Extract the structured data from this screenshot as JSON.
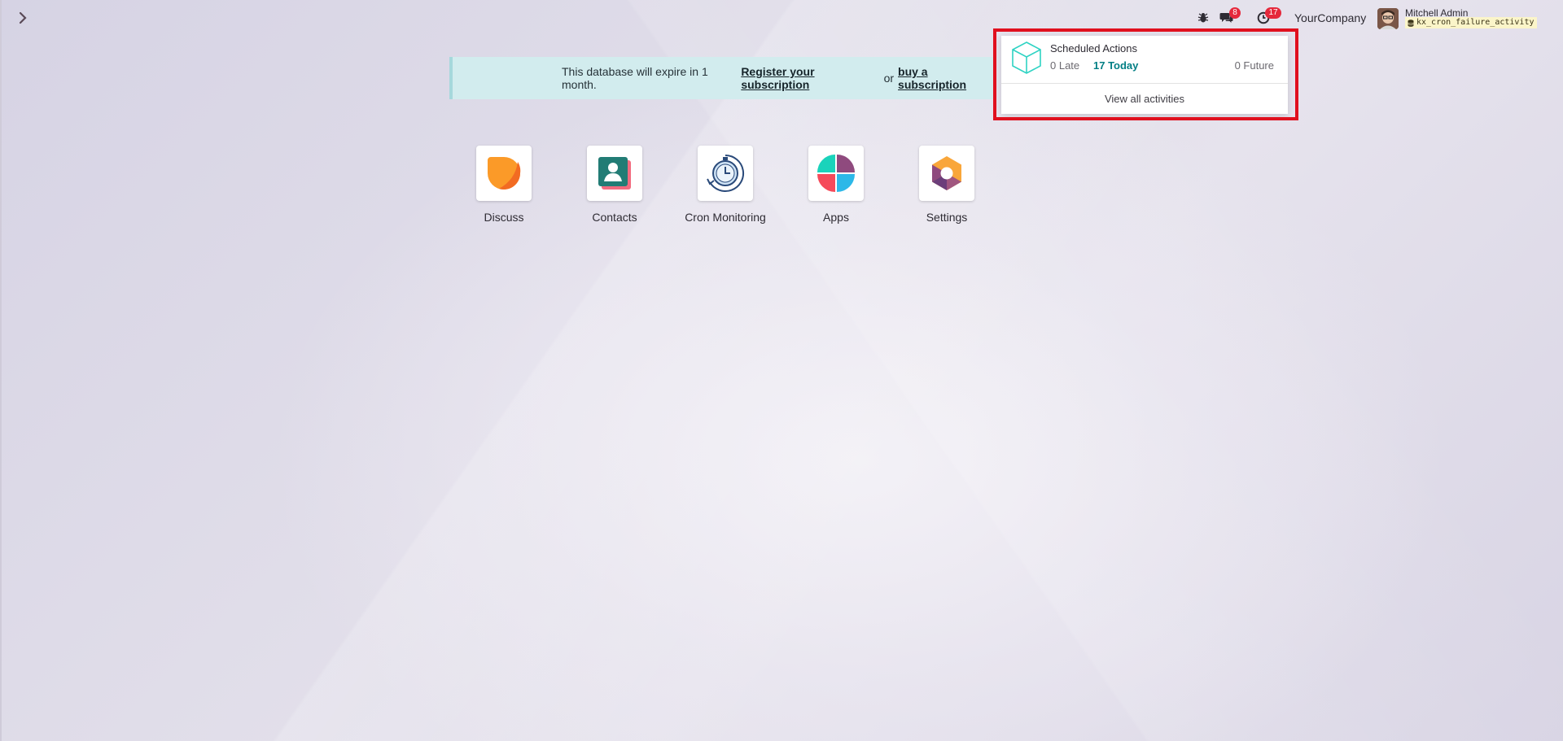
{
  "topbar": {
    "company": "YourCompany",
    "user_name": "Mitchell Admin",
    "database": "kx_cron_failure_activity",
    "messages_count": "8",
    "activities_count": "17",
    "icons": [
      "chevron-right-icon",
      "bug-icon",
      "chat-icon",
      "clock-icon",
      "database-icon"
    ]
  },
  "banner": {
    "text": "This database will expire in 1 month.",
    "register_link": "Register your subscription",
    "or": "or",
    "buy_link": "buy a subscription"
  },
  "apps": [
    {
      "label": "Discuss",
      "icon": "discuss-icon"
    },
    {
      "label": "Contacts",
      "icon": "contacts-icon"
    },
    {
      "label": "Cron Monitoring",
      "icon": "cron-monitoring-icon"
    },
    {
      "label": "Apps",
      "icon": "apps-icon"
    },
    {
      "label": "Settings",
      "icon": "settings-icon"
    }
  ],
  "activity_popover": {
    "items": [
      {
        "name": "Scheduled Actions",
        "late": "0 Late",
        "today": "17 Today",
        "future": "0 Future",
        "icon": "cube-icon"
      }
    ],
    "view_all": "View all activities"
  },
  "colors": {
    "badge": "#e5283b",
    "accent": "#017e84",
    "banner_bg": "#d2ecee",
    "highlight": "#e0101e"
  }
}
